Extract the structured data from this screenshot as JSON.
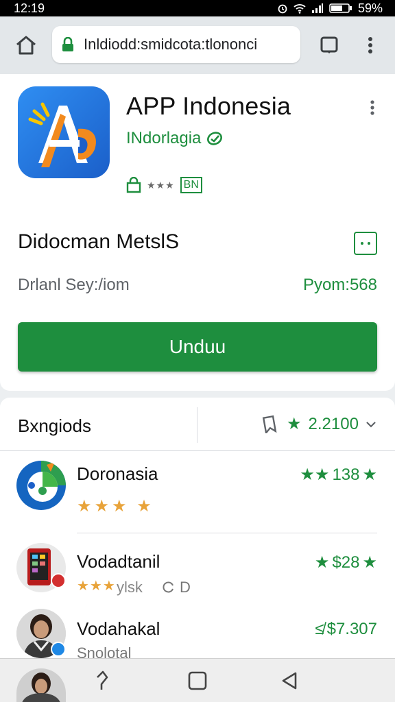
{
  "status_bar": {
    "time": "12:19",
    "battery": "59%"
  },
  "browser": {
    "url": "Inldiodd:smidcota:tlononci"
  },
  "app": {
    "title": "APP Indonesia",
    "developer": "INdorlagia",
    "age_badge": "BN",
    "section_title": "Didocman MetslS",
    "info_left": "Drlanl Sey:/iom",
    "info_right": "Pyom:568",
    "install_label": "Unduu"
  },
  "list": {
    "title": "Bxngiods",
    "score": "2.2100",
    "items": [
      {
        "name": "Doronasia",
        "rating": "138"
      },
      {
        "name": "Vodadtanil",
        "rating": "$28",
        "sub": "ylsk",
        "sub_extra": "D"
      },
      {
        "name": "Vodahakal",
        "rating": "$7.307",
        "sub": "Snolotal"
      }
    ]
  },
  "colors": {
    "accent": "#1e8e3e",
    "star": "#e8a33a",
    "icon_bg": "#2f8ef2"
  }
}
